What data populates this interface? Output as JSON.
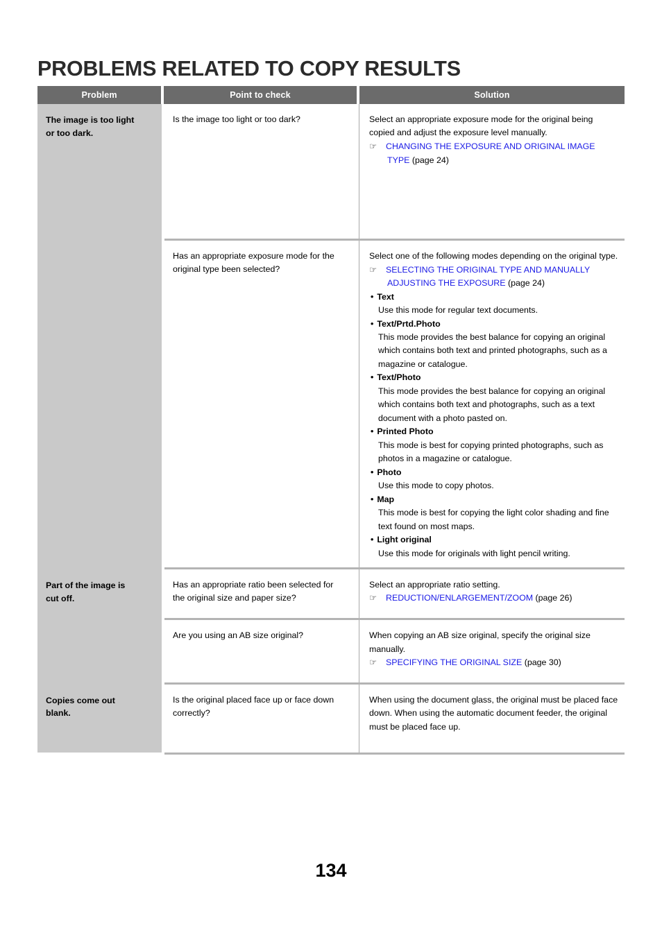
{
  "document": {
    "title": "PROBLEMS RELATED TO COPY RESULTS",
    "page_number": "134"
  },
  "icons": {
    "pointing_hand": "☞"
  },
  "colors": {
    "header_bg": "#6b6b6b",
    "problem_cell_bg": "#c9c9c9",
    "link": "#1a1ae6",
    "divider": "#b4b4b4"
  },
  "table": {
    "headers": {
      "problem": "Problem",
      "point_to_check": "Point to check",
      "solution": "Solution"
    },
    "groups": [
      {
        "problem": "The image is too light\nor too dark.",
        "problem_line1": "The image is too light",
        "problem_line2": "or too dark.",
        "rows": [
          {
            "point": "Is the image too light or too dark?",
            "solution_intro": "Select an appropriate exposure mode for the original being copied and adjust the exposure level manually.",
            "reference": "CHANGING THE EXPOSURE AND ORIGINAL IMAGE TYPE",
            "reference_page": "(page 24)"
          },
          {
            "point": "Has an appropriate exposure mode for the original type been selected?",
            "solution_intro": "Select one of the following modes depending on the original type.",
            "reference": "SELECTING THE ORIGINAL TYPE AND MANUALLY ADJUSTING THE EXPOSURE",
            "reference_page": "(page 24)",
            "modes": [
              {
                "name": "Text",
                "description": "Use this mode for regular text documents."
              },
              {
                "name": "Text/Prtd.Photo",
                "description": "This mode provides the best balance for copying an original which contains both text and printed photographs, such as a magazine or catalogue."
              },
              {
                "name": "Text/Photo",
                "description": "This mode provides the best balance for copying an original which contains both text and photographs, such as a text document with a photo pasted on."
              },
              {
                "name": "Printed Photo",
                "description": "This mode is best for copying printed photographs, such as photos in a magazine or catalogue."
              },
              {
                "name": "Photo",
                "description": "Use this mode to copy photos."
              },
              {
                "name": "Map",
                "description": "This mode is best for copying the light color shading and fine text found on most maps."
              },
              {
                "name": "Light original",
                "description": "Use this mode for originals with light pencil writing."
              }
            ]
          }
        ]
      },
      {
        "problem": "Part of the image is\ncut off.",
        "problem_line1": "Part of the image is",
        "problem_line2": "cut off.",
        "rows": [
          {
            "point": "Has an appropriate ratio been selected for the original size and paper size?",
            "solution_intro": "Select an appropriate ratio setting.",
            "reference": "REDUCTION/ENLARGEMENT/ZOOM",
            "reference_page": "(page 26)"
          },
          {
            "point": "Are you using an AB size original?",
            "solution_intro": "When copying an AB size original, specify the original size manually.",
            "reference": "SPECIFYING THE ORIGINAL SIZE",
            "reference_page": "(page 30)"
          }
        ]
      },
      {
        "problem": "Copies come out\nblank.",
        "problem_line1": "Copies come out",
        "problem_line2": "blank.",
        "rows": [
          {
            "point": "Is the original placed face up or face down correctly?",
            "solution_intro": "When using the document glass, the original must be placed face down. When using the automatic document feeder, the original must be placed face up.",
            "reference": "",
            "reference_page": ""
          }
        ]
      }
    ]
  }
}
